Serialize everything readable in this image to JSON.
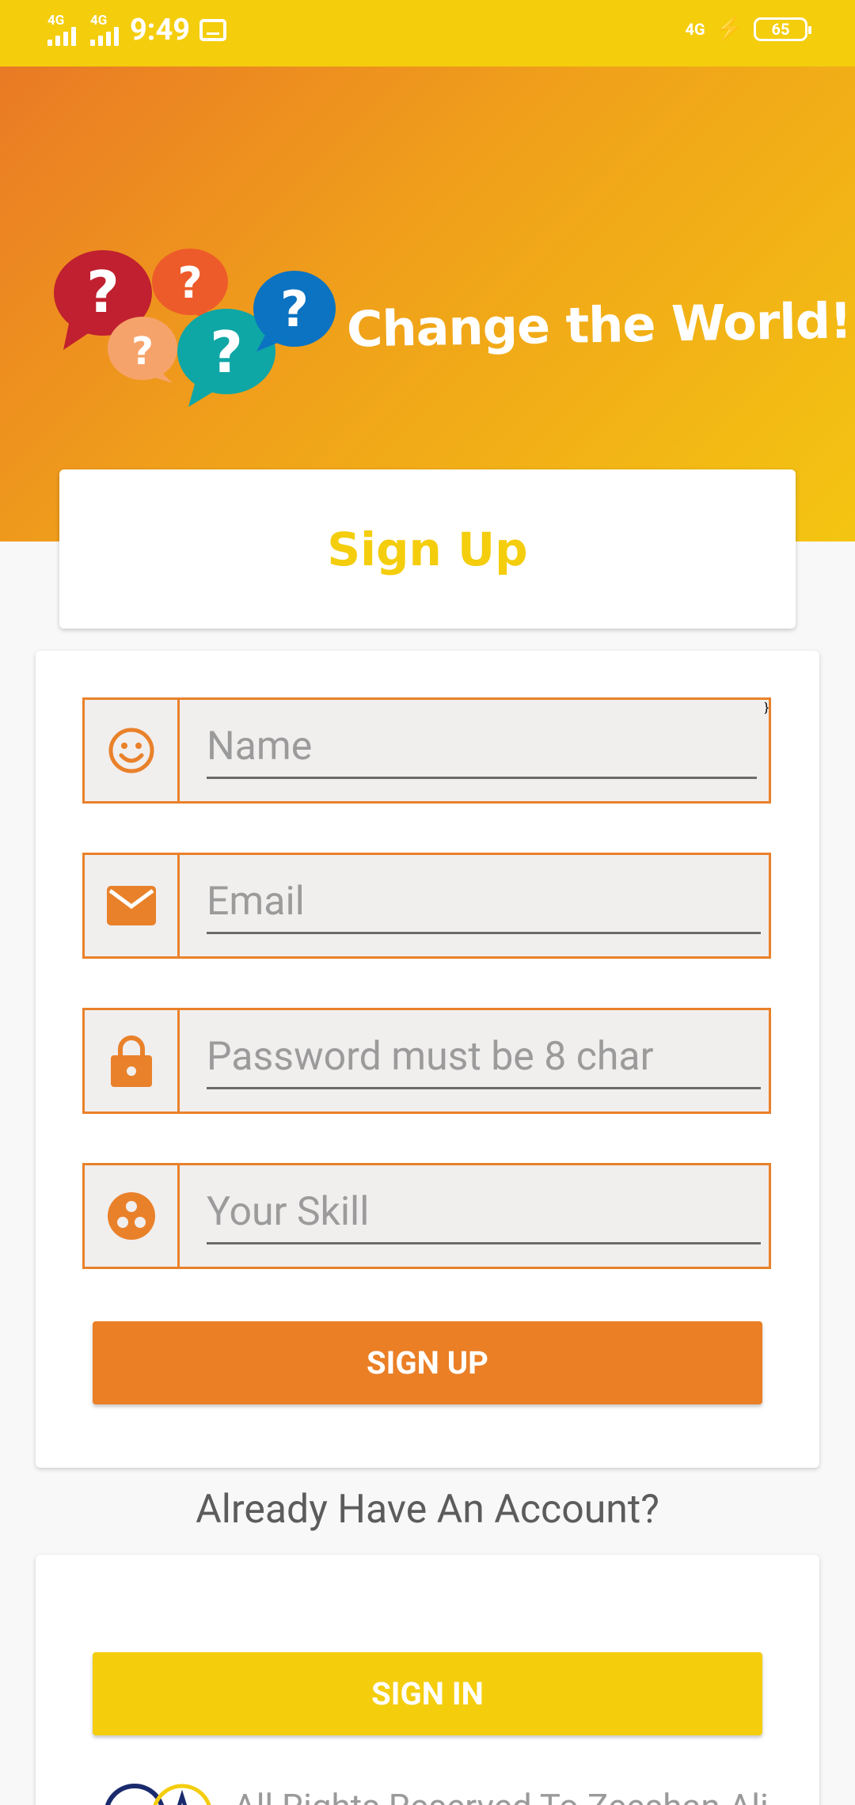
{
  "status_bar": {
    "network1": "4G",
    "network2": "4G",
    "time": "9:49",
    "right_network": "4G",
    "battery": "65"
  },
  "header": {
    "tagline": "Change the World!",
    "logo_marks": [
      "?",
      "?",
      "?",
      "?",
      "?"
    ]
  },
  "signup_card": {
    "title": "Sign Up"
  },
  "form": {
    "name_placeholder": "Name",
    "email_placeholder": "Email",
    "password_placeholder": "Password must be 8 char",
    "skill_placeholder": "Your Skill",
    "signup_button": "SIGN UP"
  },
  "already_text": "Already Have An Account?",
  "signin": {
    "button": "SIGN IN",
    "footer_text": "All Rights Reserved To Zeeshan Ali"
  },
  "colors": {
    "yellow": "#f4cd0d",
    "orange": "#ea7f26",
    "field_bg": "#f1eeee"
  }
}
